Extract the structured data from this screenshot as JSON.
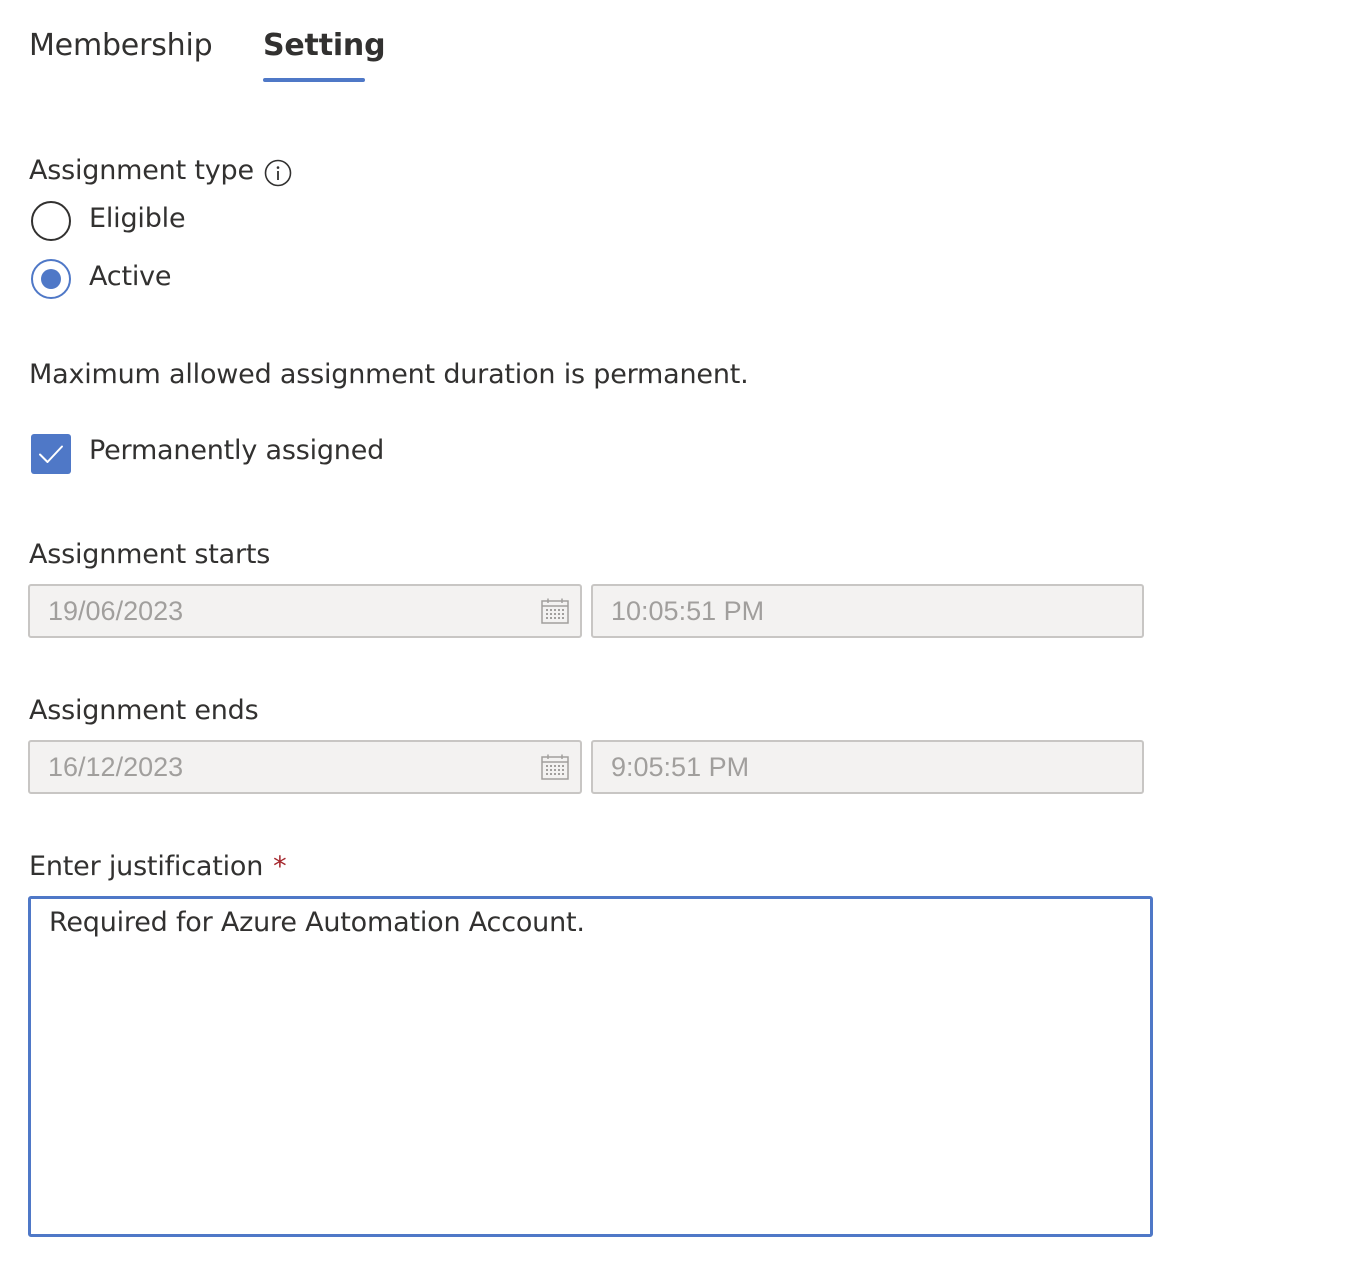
{
  "tabs": [
    {
      "label": "Membership",
      "active": false
    },
    {
      "label": "Setting",
      "active": true
    }
  ],
  "assignment_type": {
    "label": "Assignment type",
    "info_icon": "info-icon",
    "options": [
      {
        "label": "Eligible",
        "selected": false
      },
      {
        "label": "Active",
        "selected": true
      }
    ]
  },
  "duration_note": "Maximum allowed assignment duration is permanent.",
  "permanently_assigned": {
    "label": "Permanently assigned",
    "checked": true
  },
  "assignment_starts": {
    "label": "Assignment starts",
    "date": "19/06/2023",
    "time": "10:05:51 PM",
    "calendar_icon": "calendar-icon"
  },
  "assignment_ends": {
    "label": "Assignment ends",
    "date": "16/12/2023",
    "time": "9:05:51 PM",
    "calendar_icon": "calendar-icon"
  },
  "justification": {
    "label": "Enter justification",
    "required_mark": "*",
    "value": "Required for Azure Automation Account."
  },
  "colors": {
    "accent": "#4f78c7",
    "text": "#323130",
    "disabled_bg": "#f3f2f1",
    "disabled_text": "#a19f9d",
    "required": "#a4262c"
  }
}
